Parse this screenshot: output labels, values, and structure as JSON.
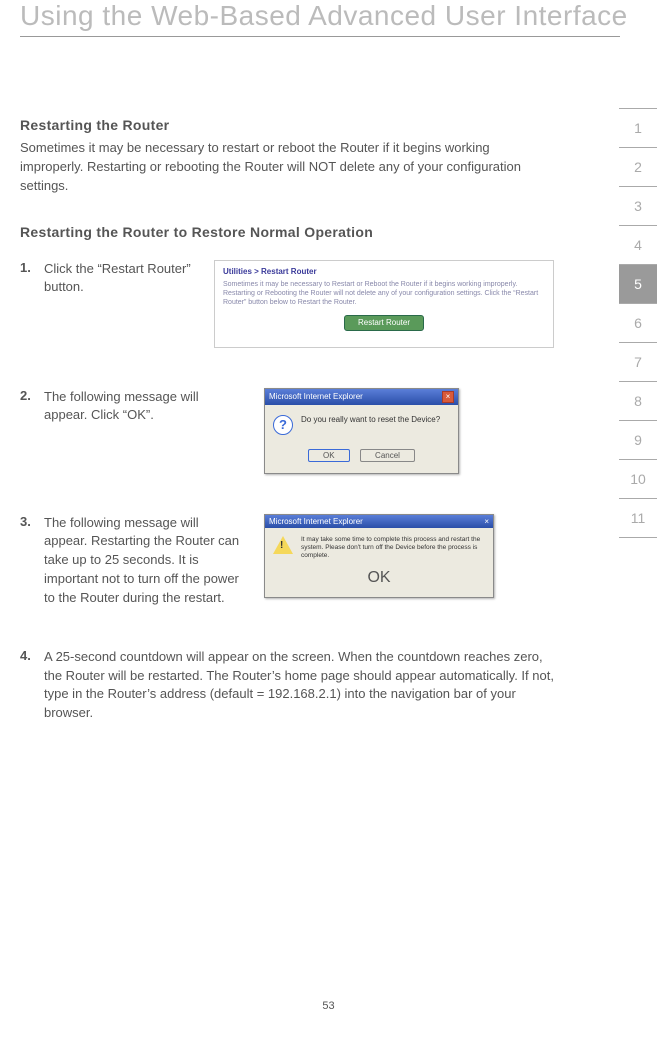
{
  "header": {
    "title": "Using the Web-Based Advanced User Interface"
  },
  "section": {
    "title": "Restarting the Router",
    "intro": "Sometimes it may be necessary to restart or reboot the Router if it begins working improperly. Restarting or rebooting the Router will NOT delete any of your configuration settings.",
    "subsection_title": "Restarting the Router to Restore Normal Operation"
  },
  "steps": [
    {
      "num": "1.",
      "text": "Click the “Restart Router” button."
    },
    {
      "num": "2.",
      "text": "The following message will appear. Click “OK”."
    },
    {
      "num": "3.",
      "text": "The following message will appear. Restarting the Router can take up to 25 seconds. It is important not to turn off the power to the Router during the restart."
    },
    {
      "num": "4.",
      "text": "A 25-second countdown will appear on the screen. When the countdown reaches zero, the Router will be restarted. The Router’s home page should appear automatically. If not, type in the Router’s address (default = 192.168.2.1) into the navigation bar of your browser."
    }
  ],
  "shot1": {
    "title": "Utilities > Restart Router",
    "body": "Sometimes it may be necessary to Restart or Reboot the Router if it begins working improperly. Restarting or Rebooting the Router will not delete any of your configuration settings. Click the “Restart Router” button below to Restart the Router.",
    "button": "Restart Router"
  },
  "shot2": {
    "titlebar": "Microsoft Internet Explorer",
    "message": "Do you really want to reset the Device?",
    "ok": "OK",
    "cancel": "Cancel"
  },
  "shot3": {
    "titlebar": "Microsoft Internet Explorer",
    "message": "It may take some time to complete this process and restart the system. Please don't turn off the Device before the process is complete.",
    "ok": "OK"
  },
  "sidetabs": {
    "items": [
      "1",
      "2",
      "3",
      "4",
      "5",
      "6",
      "7",
      "8",
      "9",
      "10",
      "11"
    ],
    "active_index": 4
  },
  "page_number": "53"
}
